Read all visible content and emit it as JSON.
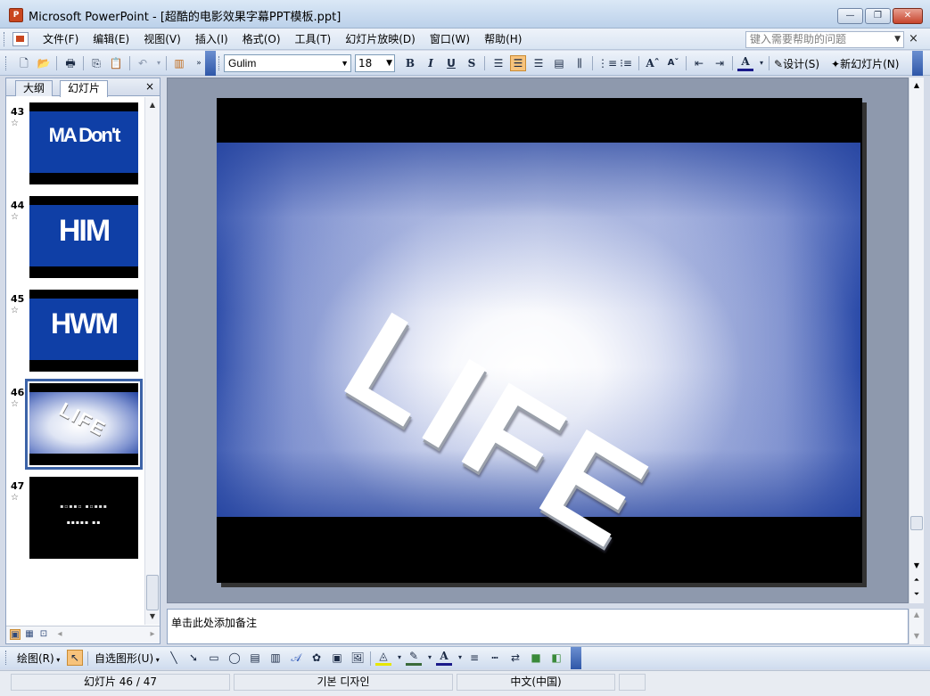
{
  "window": {
    "title": "Microsoft PowerPoint - [超酷的电影效果字幕PPT模板.ppt]",
    "app_icon_label": "P",
    "minimize": "—",
    "restore": "❐",
    "close": "✕"
  },
  "menu": {
    "items": [
      "文件(F)",
      "编辑(E)",
      "视图(V)",
      "插入(I)",
      "格式(O)",
      "工具(T)",
      "幻灯片放映(D)",
      "窗口(W)",
      "帮助(H)"
    ],
    "help_placeholder": "键入需要帮助的问题",
    "close_glyph": "×"
  },
  "toolbar": {
    "font_name": "Gulim",
    "font_size": "18",
    "bold": "B",
    "italic": "I",
    "underline": "U",
    "shadow": "S",
    "font_color": "A",
    "design_label": "设计(S)",
    "new_slide_label": "新幻灯片(N)"
  },
  "left_pane": {
    "tabs": [
      "大纲",
      "幻灯片"
    ],
    "close_glyph": "×",
    "slides": [
      {
        "number": "43",
        "text": "MA Don't",
        "kind": "title"
      },
      {
        "number": "44",
        "text": "HIM",
        "kind": "title"
      },
      {
        "number": "45",
        "text": "HWM",
        "kind": "title"
      },
      {
        "number": "46",
        "text": "LIFE",
        "kind": "life"
      },
      {
        "number": "47",
        "text": "",
        "kind": "credits"
      }
    ]
  },
  "slide": {
    "main_text": "LIFE"
  },
  "notes": {
    "placeholder": "单击此处添加备注"
  },
  "drawbar": {
    "draw_label": "绘图(R)",
    "autoshape_label": "自选图形(U)"
  },
  "status": {
    "slide_position": "幻灯片 46 / 47",
    "design": "기본 디자인",
    "language": "中文(中国)"
  },
  "colors": {
    "slide_blue": "#2a4aa8",
    "thumb_blue": "#0f3fa6",
    "selection": "#3c63a8",
    "active_button": "#f7c37c"
  }
}
